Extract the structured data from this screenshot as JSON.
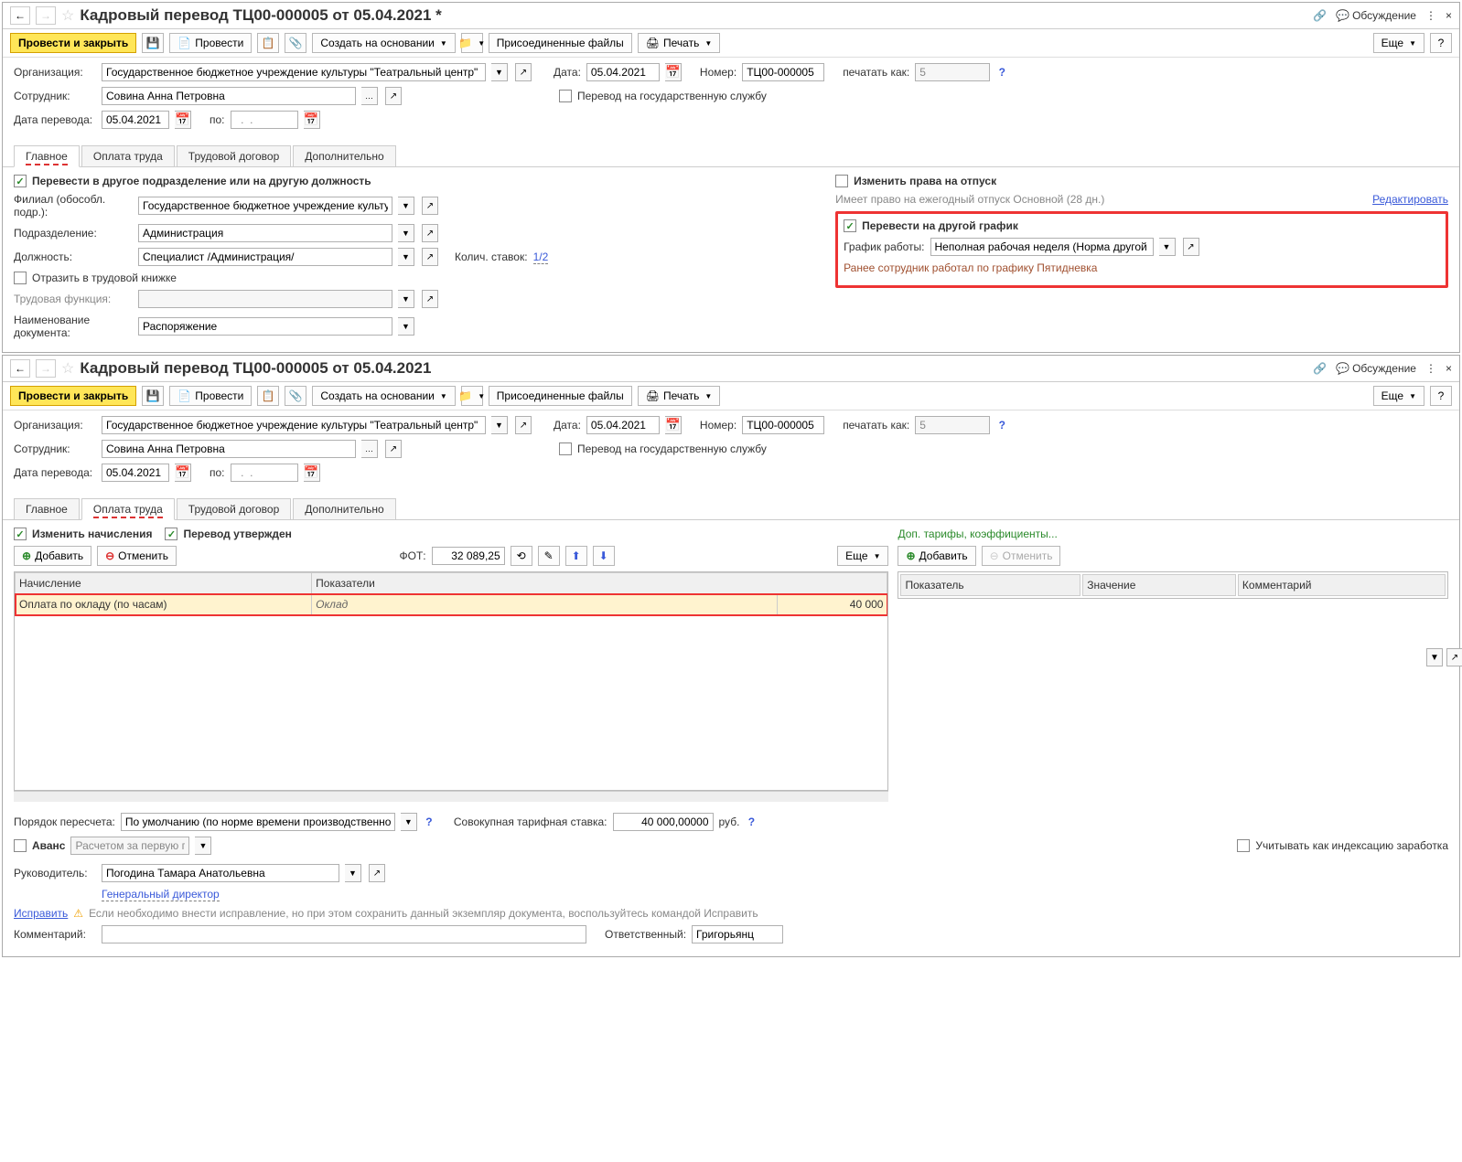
{
  "win1": {
    "title": "Кадровый перевод ТЦ00-000005 от 05.04.2021 *",
    "discuss": "Обсуждение",
    "toolbar": {
      "post_close": "Провести и закрыть",
      "post": "Провести",
      "create_based": "Создать на основании",
      "attached": "Присоединенные файлы",
      "print": "Печать",
      "more": "Еще"
    },
    "labels": {
      "org": "Организация:",
      "date": "Дата:",
      "number": "Номер:",
      "print_as": "печатать как:",
      "employee": "Сотрудник:",
      "gov_transfer": "Перевод на государственную службу",
      "transfer_date": "Дата перевода:",
      "to": "по:"
    },
    "values": {
      "org": "Государственное бюджетное учреждение культуры \"Театральный центр\"",
      "date": "05.04.2021",
      "number": "ТЦ00-000005",
      "print_as": "5",
      "employee": "Совина Анна Петровна",
      "transfer_date": "05.04.2021",
      "to_date": "  .  .    "
    },
    "tabs": [
      "Главное",
      "Оплата труда",
      "Трудовой договор",
      "Дополнительно"
    ],
    "main": {
      "transfer_check": "Перевести в другое подразделение или на другую должность",
      "branch_label": "Филиал (обособл. подр.):",
      "branch": "Государственное бюджетное учреждение культуры \"Театра",
      "dept_label": "Подразделение:",
      "dept": "Администрация",
      "pos_label": "Должность:",
      "pos": "Специалист /Администрация/",
      "rates_label": "Колич. ставок:",
      "rates": "1/2",
      "workbook": "Отразить в трудовой книжке",
      "func_label": "Трудовая функция:",
      "doc_name_label": "Наименование документа:",
      "doc_name": "Распоряжение",
      "vacation_check": "Изменить права на отпуск",
      "vacation_text": "Имеет право на ежегодный отпуск Основной (28 дн.)",
      "edit": "Редактировать",
      "schedule_check": "Перевести на другой график",
      "schedule_label": "График работы:",
      "schedule": "Неполная рабочая неделя (Норма другой график)",
      "prev_schedule": "Ранее сотрудник работал по графику Пятидневка"
    }
  },
  "win2": {
    "title": "Кадровый перевод ТЦ00-000005 от 05.04.2021",
    "pay": {
      "change_accruals": "Изменить начисления",
      "approved": "Перевод утвержден",
      "add": "Добавить",
      "cancel": "Отменить",
      "fot": "ФОТ:",
      "fot_val": "32 089,25",
      "more": "Еще",
      "table": {
        "th1": "Начисление",
        "th2": "Показатели",
        "r1c1": "Оплата по окладу (по часам)",
        "r1c2": "Оклад",
        "r1c3": "40 000"
      },
      "extra": "Доп. тарифы, коэффициенты...",
      "cols": [
        "Показатель",
        "Значение",
        "Комментарий"
      ],
      "recalc_label": "Порядок пересчета:",
      "recalc_val": "По умолчанию (по норме времени производственного календар",
      "agg_rate_label": "Совокупная тарифная ставка:",
      "agg_rate": "40 000,00000",
      "rub": "руб.",
      "advance": "Аванс",
      "advance_val": "Расчетом за первую поло",
      "index": "Учитывать как индексацию заработка",
      "manager_label": "Руководитель:",
      "manager": "Погодина Тамара Анатольевна",
      "manager_pos": "Генеральный директор",
      "fix": "Исправить",
      "fix_text": "Если необходимо внести исправление, но при этом сохранить данный экземпляр документа, воспользуйтесь командой Исправить",
      "comment_label": "Комментарий:",
      "resp_label": "Ответственный:",
      "resp": "Григорьянц"
    }
  }
}
